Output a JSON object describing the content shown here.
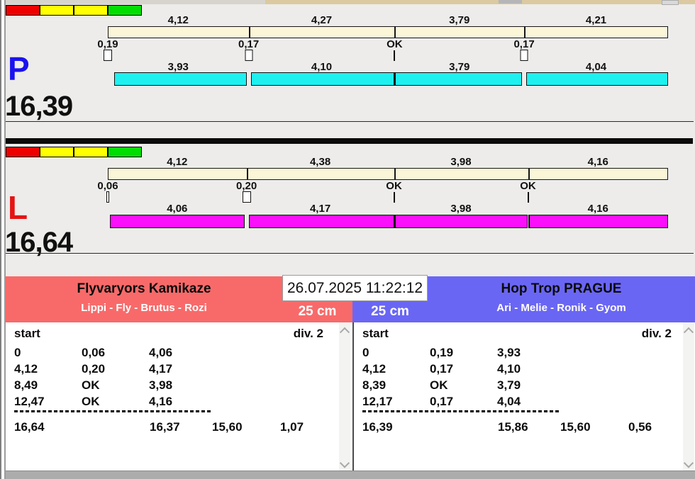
{
  "window": {
    "datetime": "26.07.2025 11:22:12"
  },
  "signal_lights": {
    "names": [
      "red",
      "yellow",
      "yellow",
      "green"
    ],
    "colors": [
      "#ee0000",
      "#ffff00",
      "#ffff00",
      "#00dd00"
    ]
  },
  "lanes": [
    {
      "id": "P",
      "letter": "P",
      "letter_color": "#1a12ee",
      "total": "16,39",
      "top_bar_color": "#fbf6d8",
      "bottom_bar_color": "#1ef0f0",
      "top_splits": [
        "4,12",
        "4,27",
        "3,79",
        "4,21"
      ],
      "changeovers": [
        {
          "label": "0,19",
          "type": "box"
        },
        {
          "label": "0,17",
          "type": "box"
        },
        {
          "label": "OK",
          "type": "line"
        },
        {
          "label": "0,17",
          "type": "box"
        }
      ],
      "bottom_splits": [
        "3,93",
        "4,10",
        "3,79",
        "4,04"
      ]
    },
    {
      "id": "L",
      "letter": "L",
      "letter_color": "#e41414",
      "total": "16,64",
      "top_bar_color": "#fbf6d8",
      "bottom_bar_color": "#fa10fa",
      "top_splits": [
        "4,12",
        "4,38",
        "3,98",
        "4,16"
      ],
      "changeovers": [
        {
          "label": "0,06",
          "type": "box"
        },
        {
          "label": "0,20",
          "type": "box"
        },
        {
          "label": "OK",
          "type": "line"
        },
        {
          "label": "OK",
          "type": "line"
        }
      ],
      "bottom_splits": [
        "4,06",
        "4,17",
        "3,98",
        "4,16"
      ]
    }
  ],
  "panels": [
    {
      "side": "left",
      "team": "Flyvaryors Kamikaze",
      "dogs": "Lippi - Fly - Brutus - Rozi",
      "jump_height": "25 cm",
      "header_color": "#f86a6a",
      "table": {
        "col_start": "start",
        "col_division": "div. 2",
        "rows": [
          [
            "0",
            "0,06",
            "4,06"
          ],
          [
            "4,12",
            "0,20",
            "4,17"
          ],
          [
            "8,49",
            "OK",
            "3,98"
          ],
          [
            "12,47",
            "OK",
            "4,16"
          ]
        ],
        "summary": [
          "16,64",
          "16,37",
          "15,60",
          "1,07"
        ]
      }
    },
    {
      "side": "right",
      "team": "Hop Trop PRAGUE",
      "dogs": "Ari - Melie - Ronik - Gyom",
      "jump_height": "25 cm",
      "header_color": "#6a66f4",
      "table": {
        "col_start": "start",
        "col_division": "div. 2",
        "rows": [
          [
            "0",
            "0,19",
            "3,93"
          ],
          [
            "4,12",
            "0,17",
            "4,10"
          ],
          [
            "8,39",
            "OK",
            "3,79"
          ],
          [
            "12,17",
            "0,17",
            "4,04"
          ]
        ],
        "summary": [
          "16,39",
          "15,86",
          "15,60",
          "0,56"
        ]
      }
    }
  ]
}
